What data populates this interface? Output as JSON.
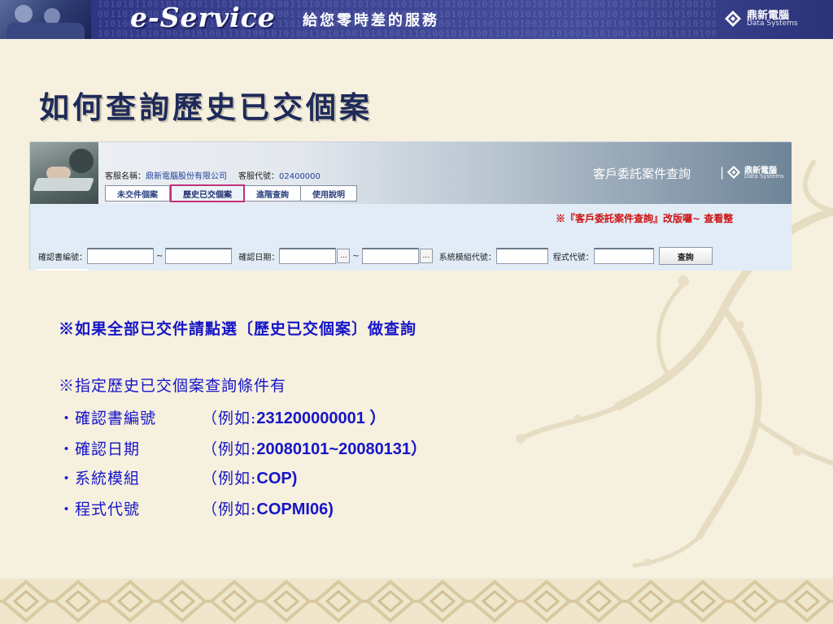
{
  "banner": {
    "title": "e-Service",
    "slogan": "給您零時差的服務",
    "brand": "鼎新電腦",
    "brand_en": "Data Systems",
    "binary_text": "1010101100101010011101001010100110101001010100111010010101001101010010101001110100101010011010100101\n0011010100101010011101001010100110101001010100111010010101001101010010101001110100101010011010100101\n1101001010100110101001010100111010010101001101010010101001110100101010011010100101010011101001010100\n1010011010100101010011101001010100110101001010100111010010101001101010010101001110100101010011010100"
  },
  "page_title": "如何查詢歷史已交個案",
  "app": {
    "service_name_label": "客服名稱：",
    "service_name_value": "鼎新電腦股份有限公司",
    "service_code_label": "客服代號：",
    "service_code_value": "02400000",
    "tabs": [
      {
        "label": "未交件個案"
      },
      {
        "label": "歷史已交個案"
      },
      {
        "label": "進階查詢"
      },
      {
        "label": "使用說明"
      }
    ],
    "query_title": "客戶委託案件查詢",
    "separator": "|",
    "brand": "鼎新電腦",
    "brand_en": "Data Systems",
    "notice": "※『客戶委託案件查詢』改版囉~ 查看整",
    "form": {
      "confirm_no_label": "確認書編號：",
      "tilde": "~",
      "confirm_date_label": "確認日期：",
      "more_btn": "...",
      "module_label": "系統模組代號：",
      "program_label": "程式代號：",
      "search_btn": "查詢"
    }
  },
  "note_main": "※如果全部已交件請點選〔歷史已交個案〕做查詢",
  "conditions_title": "※指定歷史已交個案查詢條件有",
  "conditions": [
    {
      "label": "・確認書編號",
      "prefix": "（例如:",
      "example": "231200000001 ）"
    },
    {
      "label": "・確認日期",
      "prefix": "（例如:",
      "example": "20080101~20080131）"
    },
    {
      "label": "・系統模組",
      "prefix": "（例如:",
      "example": "COP)"
    },
    {
      "label": "・程式代號",
      "prefix": "（例如:",
      "example": "COPMI06)"
    }
  ],
  "colors": {
    "background": "#f6f0de",
    "banner": "#3d4593",
    "title": "#1e2a5a",
    "instruction_text": "#1515c8",
    "notice_red": "#cc1111",
    "active_tab_border": "#c2307c"
  },
  "icons": [
    "logo-diamond-icon"
  ]
}
